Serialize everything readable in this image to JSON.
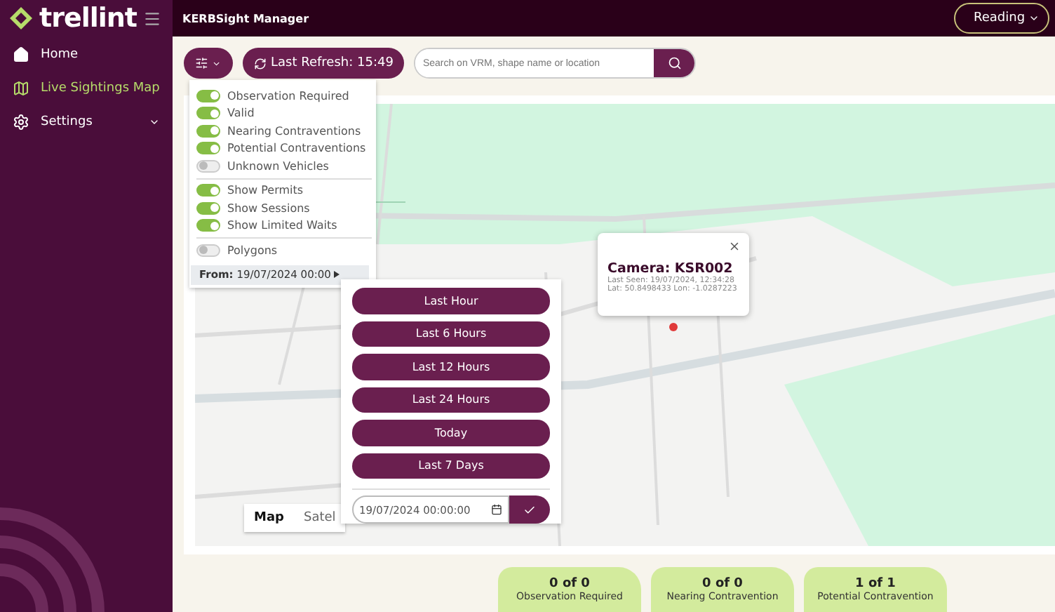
{
  "brand": {
    "name": "trellint"
  },
  "app_title": "KERBSight Manager",
  "location_select": {
    "value": "Reading"
  },
  "nav": [
    {
      "kind": "home",
      "label": "Home",
      "selected": false,
      "expandable": false
    },
    {
      "kind": "map",
      "label": "Live Sightings Map",
      "selected": true,
      "expandable": false
    },
    {
      "kind": "settings",
      "label": "Settings",
      "selected": false,
      "expandable": true
    }
  ],
  "toolbar": {
    "refresh_button": "Last Refresh: 15:49",
    "search": {
      "placeholder": "Search on VRM, shape name or location"
    }
  },
  "filters": {
    "groups": [
      [
        {
          "label": "Observation Required",
          "on": true
        },
        {
          "label": "Valid",
          "on": true
        },
        {
          "label": "Nearing Contraventions",
          "on": true
        },
        {
          "label": "Potential Contraventions",
          "on": true
        },
        {
          "label": "Unknown Vehicles",
          "on": false
        }
      ],
      [
        {
          "label": "Show Permits",
          "on": true
        },
        {
          "label": "Show Sessions",
          "on": true
        },
        {
          "label": "Show Limited Waits",
          "on": true
        }
      ],
      [
        {
          "label": "Polygons",
          "on": false
        }
      ]
    ],
    "from_button": "**From:** 19/07/2024 00:00"
  },
  "time_presets": [
    "Last Hour",
    "Last 6 Hours",
    "Last 12 Hours",
    "Last 24 Hours",
    "Today",
    "Last 7 Days"
  ],
  "date_field": {
    "value": "19/07/2024 00:00:00"
  },
  "map": {
    "type_buttons": [
      {
        "label": "Map",
        "selected": true
      },
      {
        "label": "Satel",
        "selected": false
      }
    ],
    "popup": {
      "title": "Camera: KSR002",
      "lines": [
        "Last Seen: 19/07/2024, 12:34:28",
        "Lat: 50.8498433 Lon: -1.0287223"
      ]
    }
  },
  "summary_tabs": [
    {
      "count": "0 of 0",
      "label": "Observation Required"
    },
    {
      "count": "0 of 0",
      "label": "Nearing Contravention"
    },
    {
      "count": "1 of 1",
      "label": "Potential Contravention"
    }
  ]
}
